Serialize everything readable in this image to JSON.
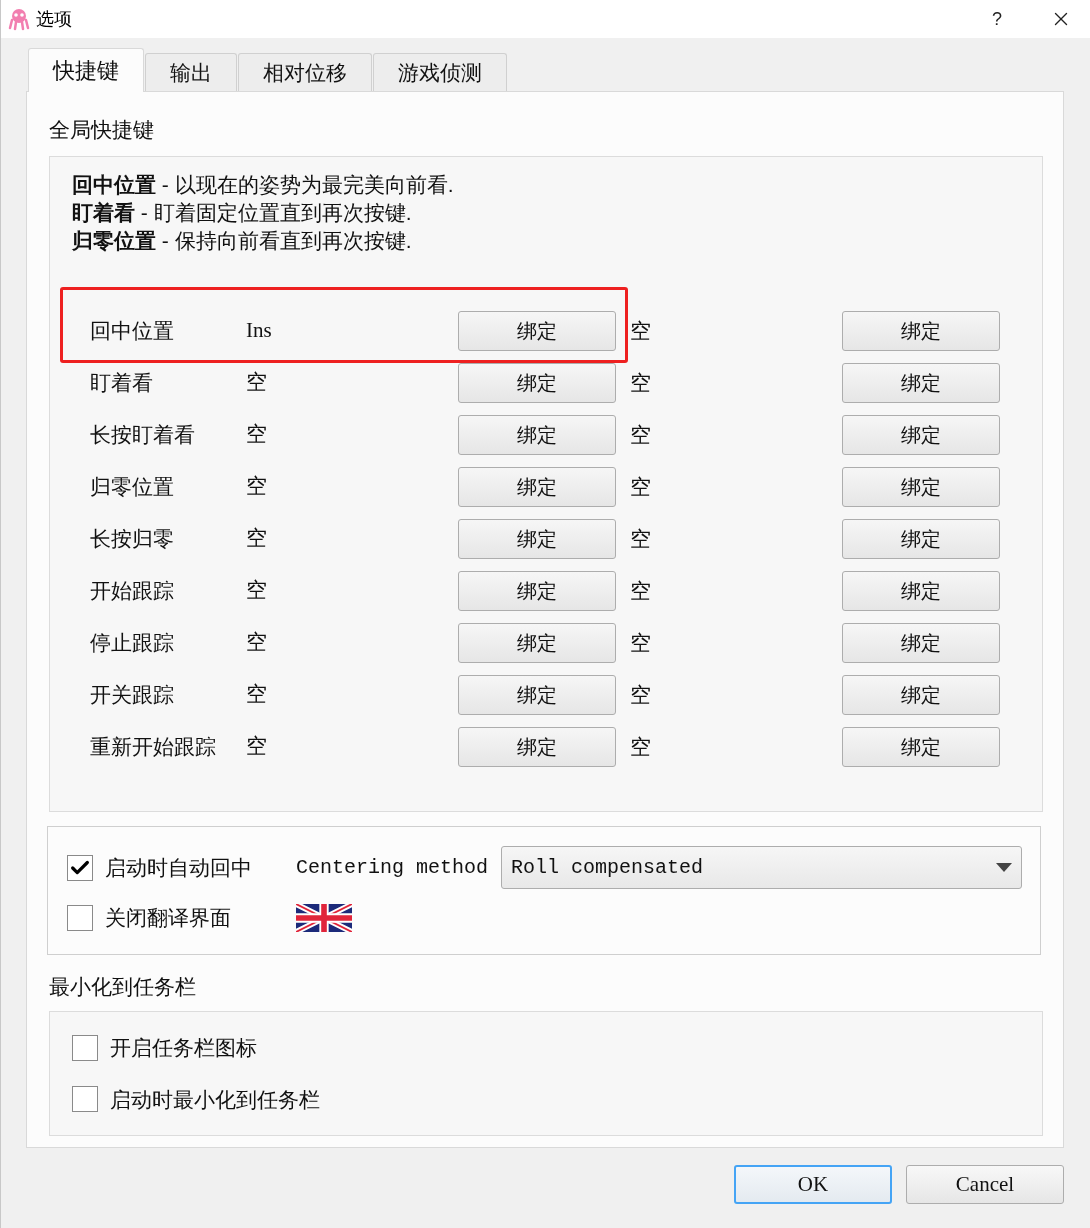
{
  "window": {
    "title": "选项",
    "help": "?"
  },
  "tabs": [
    {
      "label": "快捷键",
      "selected": true
    },
    {
      "label": "输出",
      "selected": false
    },
    {
      "label": "相对位移",
      "selected": false
    },
    {
      "label": "游戏侦测",
      "selected": false
    }
  ],
  "global_hotkeys": {
    "title": "全局快捷键",
    "descriptions": [
      "**回中位置** - 以现在的姿势为最完美向前看.",
      "**盯着看** - 盯着固定位置直到再次按键.",
      "**归零位置** - 保持向前看直到再次按键."
    ],
    "rows": [
      {
        "action": "回中位置",
        "primary_key": "Ins",
        "primary_button": "绑定",
        "secondary_key": "空",
        "secondary_button": "绑定",
        "highlighted": true
      },
      {
        "action": "盯着看",
        "primary_key": "空",
        "primary_button": "绑定",
        "secondary_key": "空",
        "secondary_button": "绑定",
        "highlighted": false
      },
      {
        "action": "长按盯着看",
        "primary_key": "空",
        "primary_button": "绑定",
        "secondary_key": "空",
        "secondary_button": "绑定",
        "highlighted": false
      },
      {
        "action": "归零位置",
        "primary_key": "空",
        "primary_button": "绑定",
        "secondary_key": "空",
        "secondary_button": "绑定",
        "highlighted": false
      },
      {
        "action": "长按归零",
        "primary_key": "空",
        "primary_button": "绑定",
        "secondary_key": "空",
        "secondary_button": "绑定",
        "highlighted": false
      },
      {
        "action": "开始跟踪",
        "primary_key": "空",
        "primary_button": "绑定",
        "secondary_key": "空",
        "secondary_button": "绑定",
        "highlighted": false
      },
      {
        "action": "停止跟踪",
        "primary_key": "空",
        "primary_button": "绑定",
        "secondary_key": "空",
        "secondary_button": "绑定",
        "highlighted": false
      },
      {
        "action": "开关跟踪",
        "primary_key": "空",
        "primary_button": "绑定",
        "secondary_key": "空",
        "secondary_button": "绑定",
        "highlighted": false
      },
      {
        "action": "重新开始跟踪",
        "primary_key": "空",
        "primary_button": "绑定",
        "secondary_key": "空",
        "secondary_button": "绑定",
        "highlighted": false
      }
    ]
  },
  "startup": {
    "checkboxes": [
      {
        "label": "启动时自动回中",
        "checked": true
      },
      {
        "label": "关闭翻译界面",
        "checked": false
      }
    ],
    "centering_label": "Centering method",
    "centering_value": "Roll compensated"
  },
  "tray": {
    "title": "最小化到任务栏",
    "checkboxes": [
      {
        "label": "开启任务栏图标",
        "checked": false
      },
      {
        "label": "启动时最小化到任务栏",
        "checked": false
      }
    ]
  },
  "buttons": [
    {
      "label": "OK",
      "default": true
    },
    {
      "label": "Cancel",
      "default": false
    }
  ]
}
